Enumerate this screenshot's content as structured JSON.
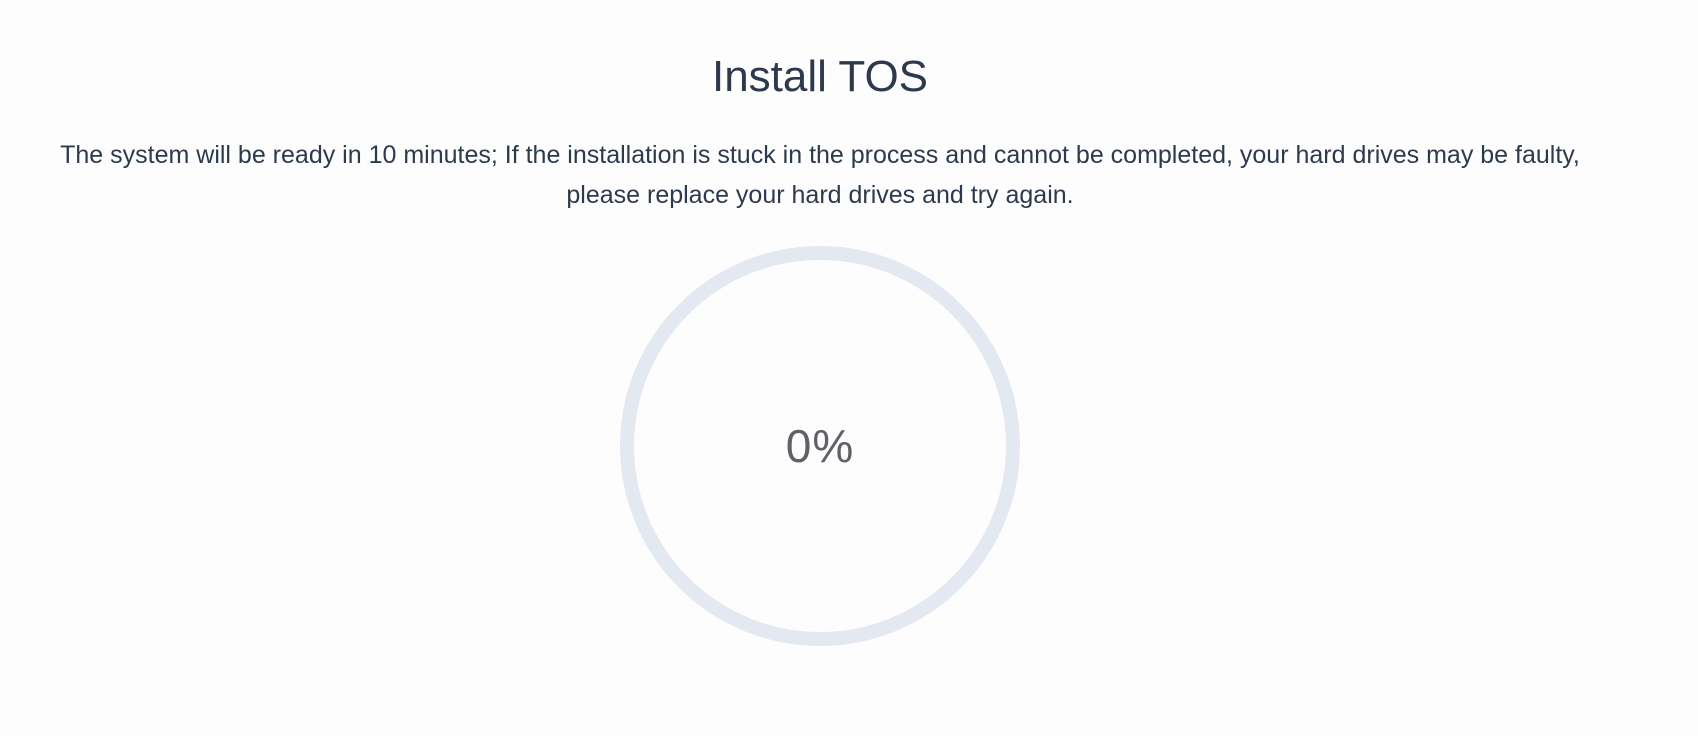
{
  "title": "Install TOS",
  "description": "The system will be ready in 10 minutes; If the installation is stuck in the process and cannot be completed, your hard drives may be faulty, please replace your hard drives and try again.",
  "progress": {
    "value": 0,
    "label": "0%",
    "track_color": "#e4e8f1",
    "fill_color": "#3d8bfd"
  }
}
